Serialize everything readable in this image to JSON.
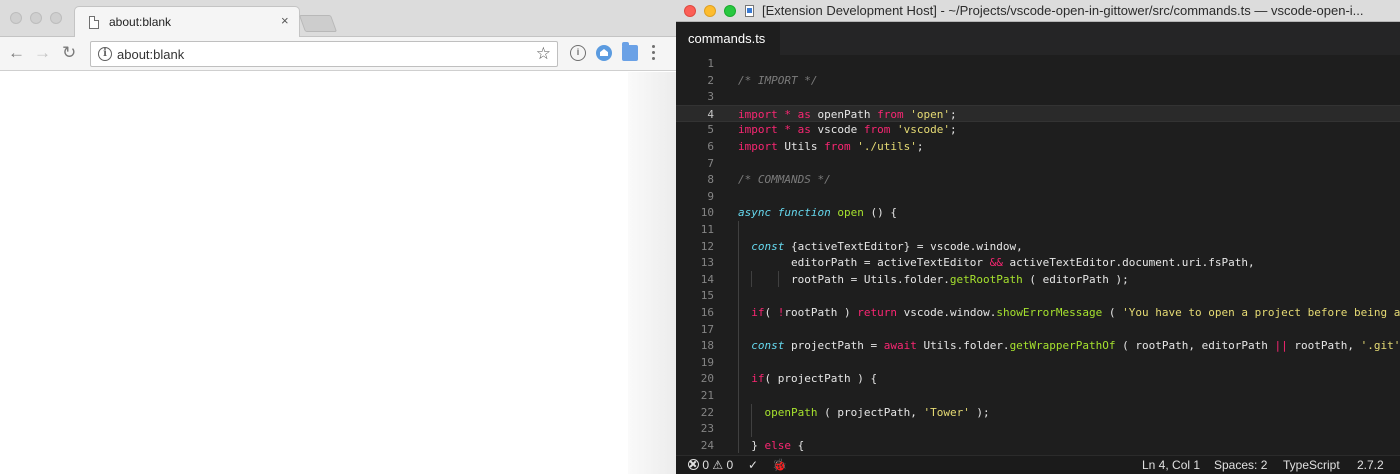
{
  "browser": {
    "tab_title": "about:blank",
    "tab_close": "×",
    "url": "about:blank",
    "icons": {
      "back": "back-arrow-icon",
      "forward": "forward-arrow-icon",
      "reload": "reload-icon",
      "info": "info-icon",
      "star": "star-icon",
      "menu": "kebab-menu-icon"
    }
  },
  "vscode": {
    "window_title": "[Extension Development Host] - ~/Projects/vscode-open-in-gittower/src/commands.ts — vscode-open-i...",
    "tab_label": "commands.ts",
    "current_line": 4,
    "lines": [
      {
        "n": "1",
        "text": ""
      },
      {
        "n": "2",
        "text": "/* IMPORT */"
      },
      {
        "n": "3",
        "text": ""
      },
      {
        "n": "4",
        "text": "import * as openPath from 'open';"
      },
      {
        "n": "5",
        "text": "import * as vscode from 'vscode';"
      },
      {
        "n": "6",
        "text": "import Utils from './utils';"
      },
      {
        "n": "7",
        "text": ""
      },
      {
        "n": "8",
        "text": "/* COMMANDS */"
      },
      {
        "n": "9",
        "text": ""
      },
      {
        "n": "10",
        "text": "async function open () {"
      },
      {
        "n": "11",
        "text": ""
      },
      {
        "n": "12",
        "text": "  const {activeTextEditor} = vscode.window,"
      },
      {
        "n": "13",
        "text": "        editorPath = activeTextEditor && activeTextEditor.document.uri.fsPath,"
      },
      {
        "n": "14",
        "text": "        rootPath = Utils.folder.getRootPath ( editorPath );"
      },
      {
        "n": "15",
        "text": ""
      },
      {
        "n": "16",
        "text": "  if ( !rootPath ) return vscode.window.showErrorMessage ( 'You have to open a project before being able"
      },
      {
        "n": "17",
        "text": ""
      },
      {
        "n": "18",
        "text": "  const projectPath = await Utils.folder.getWrapperPathOf ( rootPath, editorPath || rootPath, '.git' );"
      },
      {
        "n": "19",
        "text": ""
      },
      {
        "n": "20",
        "text": "  if ( projectPath ) {"
      },
      {
        "n": "21",
        "text": ""
      },
      {
        "n": "22",
        "text": "    openPath ( projectPath, 'Tower' );"
      },
      {
        "n": "23",
        "text": ""
      },
      {
        "n": "24",
        "text": "  } else {"
      }
    ],
    "status": {
      "errors": "0",
      "warnings": "0",
      "check": "✓",
      "bug": "🐞",
      "position": "Ln 4, Col 1",
      "spaces": "Spaces: 2",
      "language": "TypeScript",
      "version": "2.7.2"
    },
    "colors": {
      "keyword": "#f92672",
      "string": "#e6db74",
      "function": "#a6e22e",
      "storage": "#66d9ef",
      "comment": "#7b7b7b"
    }
  }
}
